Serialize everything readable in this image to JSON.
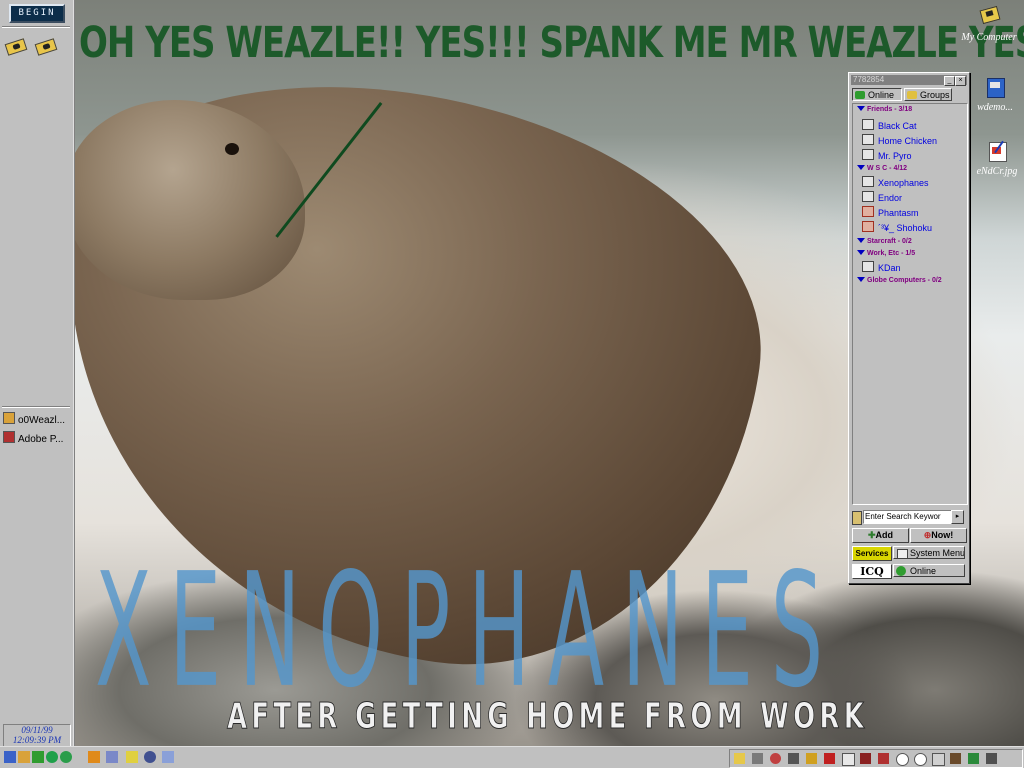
{
  "wallpaper": {
    "headline": "OH YES WEAZLE!! YES!!! SPANK ME MR WEAZLE YES!!",
    "big_name": "XENOPHANES",
    "caption": "AFTER GETTING HOME FROM WORK"
  },
  "sidebar": {
    "begin_label": "BEGIN",
    "quick_launch": [
      "camera-icon",
      "camera-icon"
    ],
    "tasks": [
      {
        "label": "o0Weazl...",
        "icon": "user-icon"
      },
      {
        "label": "Adobe P...",
        "icon": "photoshop-icon"
      }
    ],
    "clock": {
      "date": "09/11/99",
      "time": "12:09:39 PM"
    }
  },
  "desktop_icons": [
    {
      "label": "My Computer",
      "icon": "computer-icon"
    },
    {
      "label": "wdemo...",
      "icon": "setup-icon"
    },
    {
      "label": "eNdCr.jpg",
      "icon": "image-file-icon"
    }
  ],
  "icq": {
    "uin": "7782854",
    "tabs": {
      "online": "Online",
      "groups": "Groups"
    },
    "groups": [
      {
        "name": "Friends - 3/18",
        "contacts": [
          "Black Cat",
          "Home Chicken",
          "Mr. Pyro"
        ]
      },
      {
        "name": "W S C - 4/12",
        "contacts": [
          "Xenophanes",
          "Endor",
          "Phantasm",
          "´³¥_ Shohoku"
        ]
      },
      {
        "name": "Starcraft - 0/2",
        "contacts": []
      },
      {
        "name": "Work, Etc - 1/5",
        "contacts": [
          "KDan"
        ]
      },
      {
        "name": "Globe Computers - 0/2",
        "contacts": []
      }
    ],
    "search_placeholder": "Enter Search Keywor",
    "add_label": "Add",
    "now_label": "Now!",
    "services_label": "Services",
    "system_menu_label": "System Menu",
    "logo_label": "ICQ",
    "status_label": "Online"
  },
  "colors": {
    "headline": "#1d5a2a",
    "big_name": "#5496cc",
    "icq_group": "#800080",
    "icq_contact": "#0000e0",
    "clock_text": "#1833b5",
    "begin_bg": "#0c2d4a"
  }
}
